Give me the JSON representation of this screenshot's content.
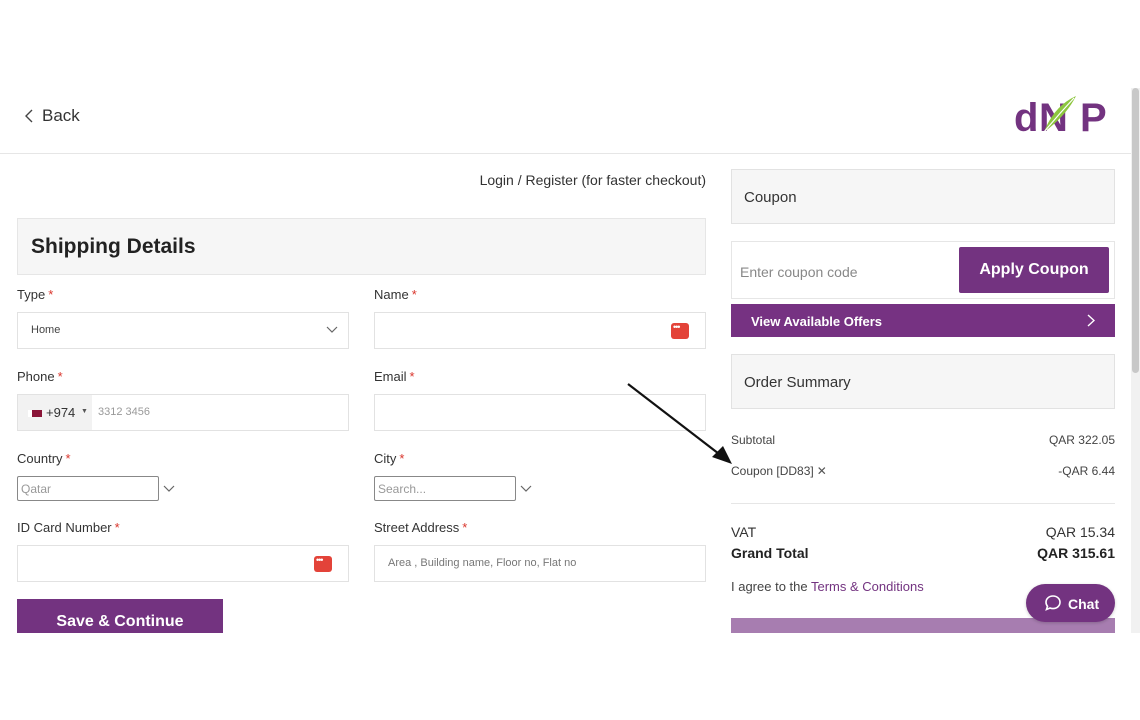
{
  "header": {
    "back_label": "Back",
    "logo_text": "dNP"
  },
  "login_link": "Login / Register (for faster checkout)",
  "shipping": {
    "title": "Shipping Details",
    "type": {
      "label": "Type",
      "value": "Home"
    },
    "name": {
      "label": "Name",
      "value": ""
    },
    "phone": {
      "label": "Phone",
      "code": "+974",
      "placeholder": "3312 3456"
    },
    "email": {
      "label": "Email",
      "value": ""
    },
    "country": {
      "label": "Country",
      "placeholder": "Qatar"
    },
    "city": {
      "label": "City",
      "placeholder": "Search..."
    },
    "id_card": {
      "label": "ID Card Number",
      "value": ""
    },
    "street": {
      "label": "Street Address",
      "placeholder": "Area , Building name, Floor no, Flat no"
    },
    "required_mark": "*",
    "save_label": "Save & Continue"
  },
  "coupon": {
    "title": "Coupon",
    "placeholder": "Enter coupon code",
    "apply_label": "Apply Coupon",
    "offers_label": "View Available Offers"
  },
  "summary": {
    "title": "Order Summary",
    "subtotal_label": "Subtotal",
    "subtotal_value": "QAR 322.05",
    "coupon_label": "Coupon [DD83]",
    "coupon_value": "-QAR 6.44",
    "vat_label": "VAT",
    "vat_value": "QAR 15.34",
    "grand_label": "Grand Total",
    "grand_value": "QAR 315.61",
    "terms_prefix": "I agree to the ",
    "terms_link": "Terms & Conditions"
  },
  "chat_label": "Chat",
  "colors": {
    "brand": "#733380",
    "required": "#d9342b",
    "logo_green": "#8dc63f"
  }
}
